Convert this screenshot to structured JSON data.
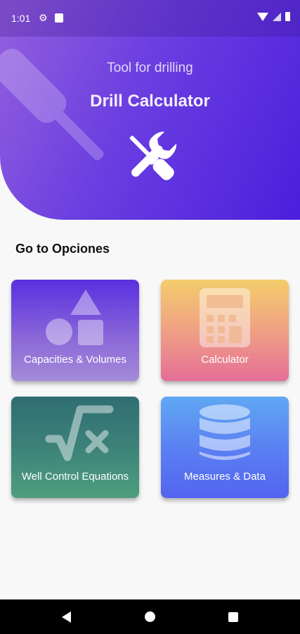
{
  "status": {
    "time": "1:01"
  },
  "header": {
    "subtitle": "Tool for drilling",
    "title": "Drill Calculator"
  },
  "section_title": "Go to Opciones",
  "cards": [
    {
      "label": "Capacities & Volumes",
      "icon": "shapes-icon"
    },
    {
      "label": "Calculator",
      "icon": "calculator-icon"
    },
    {
      "label": "Well Control Equations",
      "icon": "square-root-icon"
    },
    {
      "label": "Measures & Data",
      "icon": "database-icon"
    }
  ],
  "colors": {
    "header_start": "#9460dd",
    "header_end": "#4b1fdc"
  }
}
